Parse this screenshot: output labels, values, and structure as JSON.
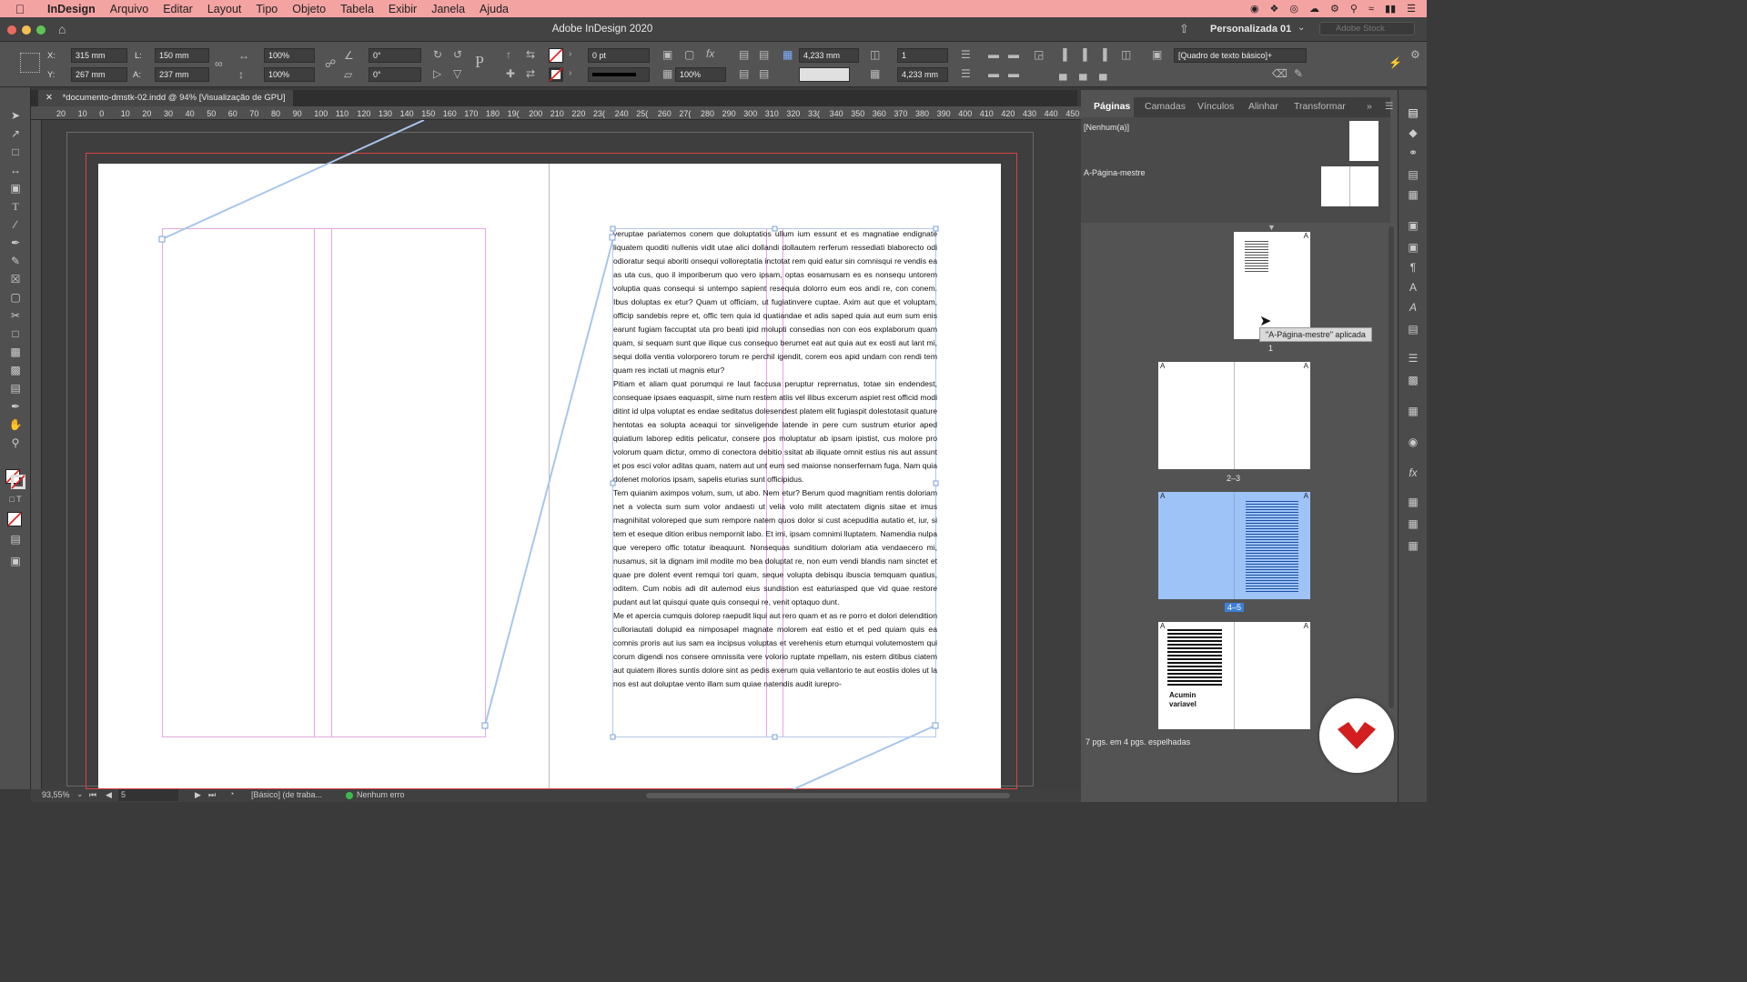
{
  "menubar": {
    "app": "InDesign",
    "items": [
      "Arquivo",
      "Editar",
      "Layout",
      "Tipo",
      "Objeto",
      "Tabela",
      "Exibir",
      "Janela",
      "Ajuda"
    ]
  },
  "window": {
    "title": "Adobe InDesign 2020",
    "workspace": "Personalizada 01",
    "stock_placeholder": "Adobe Stock"
  },
  "control": {
    "x_label": "X:",
    "x_value": "315 mm",
    "y_label": "Y:",
    "y_value": "267 mm",
    "w_label": "L:",
    "w_value": "150 mm",
    "h_label": "A:",
    "h_value": "237 mm",
    "scale_x": "100%",
    "scale_y": "100%",
    "rotate": "0°",
    "shear": "0°",
    "stroke_weight": "0 pt",
    "opacity": "100%",
    "inset1": "4,233 mm",
    "inset2": "4,233 mm",
    "columns": "1",
    "object_style": "[Quadro de texto básico]+"
  },
  "document": {
    "tab_label": "*documento-dmstk-02.indd @ 94% [Visualização de GPU]",
    "ruler_ticks": [
      "20",
      "10",
      "0",
      "10",
      "20",
      "30",
      "40",
      "50",
      "60",
      "70",
      "80",
      "90",
      "100",
      "110",
      "120",
      "130",
      "140",
      "150",
      "160",
      "170",
      "180",
      "19(",
      "200",
      "210",
      "220",
      "23(",
      "240",
      "25(",
      "260",
      "27(",
      "280",
      "290",
      "300",
      "310",
      "320",
      "33(",
      "340",
      "350",
      "360",
      "370",
      "380",
      "390",
      "400",
      "410",
      "420",
      "430",
      "440",
      "450"
    ],
    "paragraphs": [
      "veruptae pariatemos conem que doluptatios ullum ium essunt et es magnatiae endignate liquatem quoditi nullenis vidit utae alici dollandi dollautem rerferum ressediati blaborecto odi odioratur sequi aboriti onsequi volloreptatia inctotat rem quid eatur sin comnisqui re vendis ea as uta cus, quo il imporiberum quo vero ipsam, optas eosamusam es es nonsequ untorem voluptia quas consequi si untempo sapient resequia dolorro eum eos andi re, con conem. Ibus doluptas ex etur? Quam ut officiam, ut fugiatinvere cuptae. Axim aut que et voluptam, officip sandebis repre et, offic tem quia id quatiandae et adis saped quia aut eum sum enis earunt fugiam faccuptat uta pro beati ipid molupti consedias non con eos explaborum quam quam, si sequam sunt que ilique cus consequo berumet eat aut quia aut ex eosti aut lant mi, sequi dolla ventia volorporero torum re perchil igendit, corem eos apid undam con rendi tem quam res inctati ut magnis etur?",
      "Pitiam et aliam quat porumqui re laut faccusa peruptur reprernatus, totae sin endendest, consequae ipsaes eaquaspit, sime num restem atiis vel ilibus excerum aspiet rest officid modi ditint id ulpa voluptat es endae seditatus dolesendest platem elit fugiaspit dolestotasit quature hentotas ea solupta aceaqui tor sinveligende latende in pere cum sustrum eturior aped quiatium laborep editis pelicatur, consere pos moluptatur ab ipsam ipistist, cus molore pro volorum quam dictur, ommo di conectora debitio ssitat ab iliquate omnit estius nis aut assunt et pos esci volor aditas quam, natem aut unt eum sed maionse nonserfernam fuga. Nam quia dolenet molorios ipsam, sapelis eturias sunt officipidus.",
      "Tem quianim aximpos volum, sum, ut abo. Nem etur? Berum quod magnitiam rentis doloriam net a volecta sum sum volor andaesti ut velia volo milit atectatem dignis sitae et imus magnihitat voloreped que sum rempore natem quos dolor si cust acepuditia autatio et, iur, si tem et eseque dition eribus nempornit labo. Et imi, ipsam comnimi lluptatem. Namendia nulpa que verepero offic totatur ibeaquunt. Nonsequas sunditium doloriam atia vendaecero mi, nusamus, sit la dignam imil modite mo bea doluptat re, non eum vendi blandis nam sinctet et quae pre dolent event remqui tori quam, seque volupta debisqu ibuscia temquam quatius, oditem. Cum nobis adi dit autemod eius sundistion est eaturiasped que vid quae restore pudant aut lat quisqui quate quis consequi re, venit optaquo dunt.",
      "Me et apercia cumquis dolorep raepudit liqui aut rero quam et as re porro et dolori delendition culloriautati dolupid ea nimposapel magnate molorem eat estio et et ped quiam quis ea comnis proris aut ius sam ea incipsus voluptas et verehenis etum etumqui volutemostem qui corum digendi nos consere omnissita vere volorio ruptate mpellam, nis estem ditibus ciatem aut quiatem illores suntis dolore sint as pedis exerum quia vellantorio te aut eostiis doles ut la nos est aut doluptae vento illam sum quiae natendis audit iurepro-"
    ]
  },
  "status": {
    "zoom": "93,55%",
    "page": "5",
    "preflight_profile": "[Básico] (de traba...",
    "errors": "Nenhum erro"
  },
  "pages_panel": {
    "tabs": [
      "Páginas",
      "Camadas",
      "Vínculos",
      "Alinhar",
      "Transformar"
    ],
    "none_label": "[Nenhum(a)]",
    "master_label": "A-Página-mestre",
    "spread_labels": [
      "1",
      "2–3",
      "4–5"
    ],
    "prefix": "A",
    "thumb_text": "Acumin variavel",
    "footer": "7 pgs. em 4 pgs. espelhadas",
    "tooltip": "\"A-Página-mestre\" aplicada",
    "selection_color": "#9ec3f7",
    "accent": "#3d7fd6"
  },
  "colors": {
    "menubar": "#f4a3a3",
    "frame_edge": "#e3a8e0",
    "thread_line": "#a8c6ee",
    "badge_red": "#d21e1e"
  }
}
